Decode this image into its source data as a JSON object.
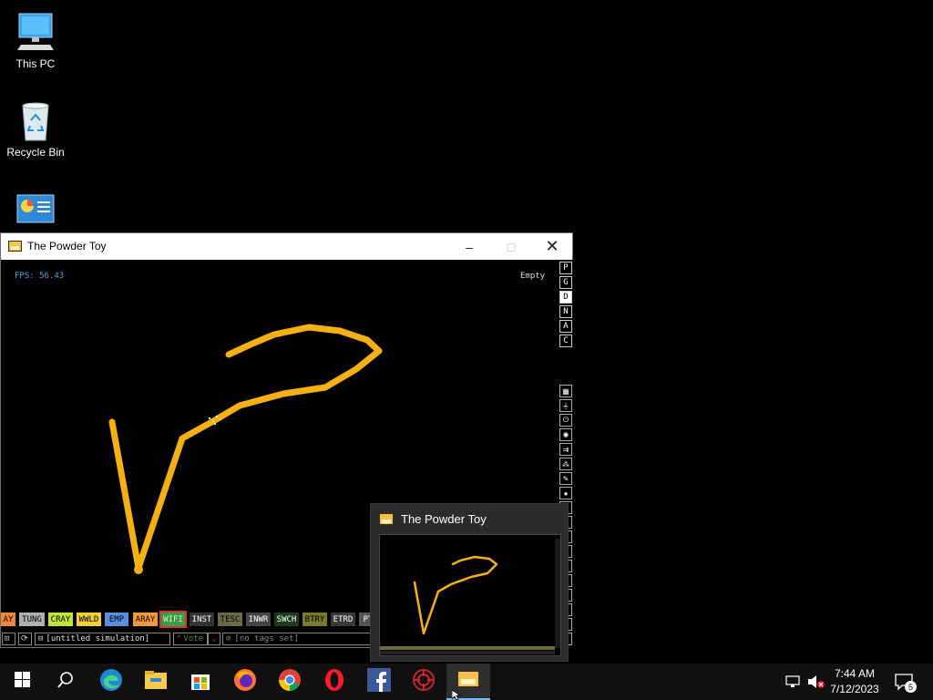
{
  "desktop": {
    "icons": [
      {
        "label": "This PC",
        "icon": "computer-icon"
      },
      {
        "label": "Recycle Bin",
        "icon": "recycle-bin-icon"
      },
      {
        "label": "",
        "icon": "control-panel-icon"
      }
    ]
  },
  "window": {
    "title": "The Powder Toy",
    "controls": {
      "minimize": "–",
      "maximize": "□",
      "close": "✕"
    }
  },
  "sim": {
    "fps": "FPS: 56.43",
    "hover_status": "Empty",
    "stroke_color": "#f5b012"
  },
  "mode_buttons": [
    "P",
    "G",
    "D",
    "N",
    "A",
    "C"
  ],
  "active_mode": "D",
  "category_icons": [
    "wall-icon",
    "electronics-icon",
    "power-icon",
    "explosive-icon",
    "sensor-icon",
    "force-icon",
    "pen-icon",
    "liquid-icon",
    "gas-icon",
    "solid-icon",
    "powder-icon",
    "radioactive-icon",
    "special-icon",
    "life-icon",
    "tools-icon",
    "favorite-icon",
    "recent-icon",
    "search-icon"
  ],
  "elements": [
    {
      "label": "AY",
      "color": "#f0863a"
    },
    {
      "label": "TUNG",
      "color": "#b0b0b0"
    },
    {
      "label": "CRAY",
      "color": "#bfe63a"
    },
    {
      "label": "WWLD",
      "color": "#f1d03a"
    },
    {
      "label": "EMP",
      "color": "#5a8fe0"
    },
    {
      "label": "ARAY",
      "color": "#f09a3a"
    },
    {
      "label": "WIFI",
      "color": "#3d9a45",
      "selected": true
    },
    {
      "label": "INST",
      "color": "#333333",
      "text": "#ffffff"
    },
    {
      "label": "TESC",
      "color": "#6a6a48"
    },
    {
      "label": "INWR",
      "color": "#444444",
      "text": "#ffffff"
    },
    {
      "label": "SWCH",
      "color": "#1e3a1e",
      "text": "#ffffff"
    },
    {
      "label": "BTRY",
      "color": "#7a7a28"
    },
    {
      "label": "ETRD",
      "color": "#383838",
      "text": "#ffffff"
    },
    {
      "label": "PT",
      "color": "#555555",
      "text": "#ffffff"
    }
  ],
  "bottom_bar": {
    "save_name": "[untitled simulation]",
    "vote_label": "Vote",
    "tags": "[no tags set]"
  },
  "preview": {
    "title": "The Powder Toy"
  },
  "taskbar": {
    "apps": [
      "start-icon",
      "search-icon",
      "edge-icon",
      "file-explorer-icon",
      "store-icon",
      "firefox-icon",
      "chrome-icon",
      "opera-icon",
      "facebook-icon",
      "app-red-icon",
      "powder-toy-icon"
    ],
    "time": "7:44 AM",
    "date": "7/12/2023",
    "notification_count": "5"
  },
  "colors": {
    "accent": "#76b9ed",
    "fps_text": "#5fa5d8",
    "taskbar_bg": "#101010"
  }
}
